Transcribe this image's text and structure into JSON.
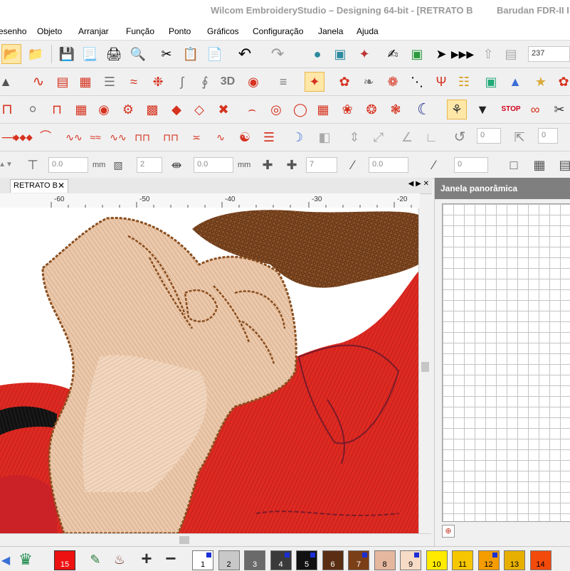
{
  "window": {
    "title": "Wilcom EmbroideryStudio – Designing 64-bit - [RETRATO B",
    "title_right": "Barudan FDR-II I"
  },
  "menu": [
    "esenho",
    "Objeto",
    "Arranjar",
    "Função",
    "Ponto",
    "Gráficos",
    "Configuração",
    "Janela",
    "Ajuda"
  ],
  "toolbar1": {
    "zoom_value": "237"
  },
  "toolbar5": {
    "field1": "0.0",
    "unit1": "mm",
    "field2": "2",
    "field3": "0.0",
    "unit2": "mm",
    "field4": "7",
    "field5": "0.0",
    "field6": "0"
  },
  "toolbar4": {
    "field1": "0",
    "field2": "0"
  },
  "document_tab": {
    "label": "RETRATO B"
  },
  "ruler": {
    "ticks": [
      "-60",
      "-50",
      "-40",
      "-30",
      "-20"
    ]
  },
  "overview_panel": {
    "title": "Janela panorâmica"
  },
  "colors": {
    "accent_red": "#d6321f",
    "panel_header": "#7f7f7f",
    "selected": "#ffe7a8"
  },
  "color_palette": [
    {
      "label": "1",
      "color": "#ffffff",
      "marked": true
    },
    {
      "label": "2",
      "color": "#c8c8c8",
      "marked": false
    },
    {
      "label": "3",
      "color": "#6a6a6a",
      "marked": false
    },
    {
      "label": "4",
      "color": "#3a3a3a",
      "marked": true
    },
    {
      "label": "5",
      "color": "#111111",
      "marked": true
    },
    {
      "label": "6",
      "color": "#5a2e12",
      "marked": false
    },
    {
      "label": "7",
      "color": "#7b3f17",
      "marked": true
    },
    {
      "label": "8",
      "color": "#e6b79f",
      "marked": false
    },
    {
      "label": "9",
      "color": "#f6dcc6",
      "marked": true
    },
    {
      "label": "10",
      "color": "#ffeb00",
      "marked": false
    },
    {
      "label": "11",
      "color": "#f6c600",
      "marked": false
    },
    {
      "label": "12",
      "color": "#f49c00",
      "marked": true
    },
    {
      "label": "13",
      "color": "#e7b000",
      "marked": false
    },
    {
      "label": "14",
      "color": "#f24a0a",
      "marked": false
    }
  ],
  "left_tools": {
    "current_color_number": "15"
  }
}
